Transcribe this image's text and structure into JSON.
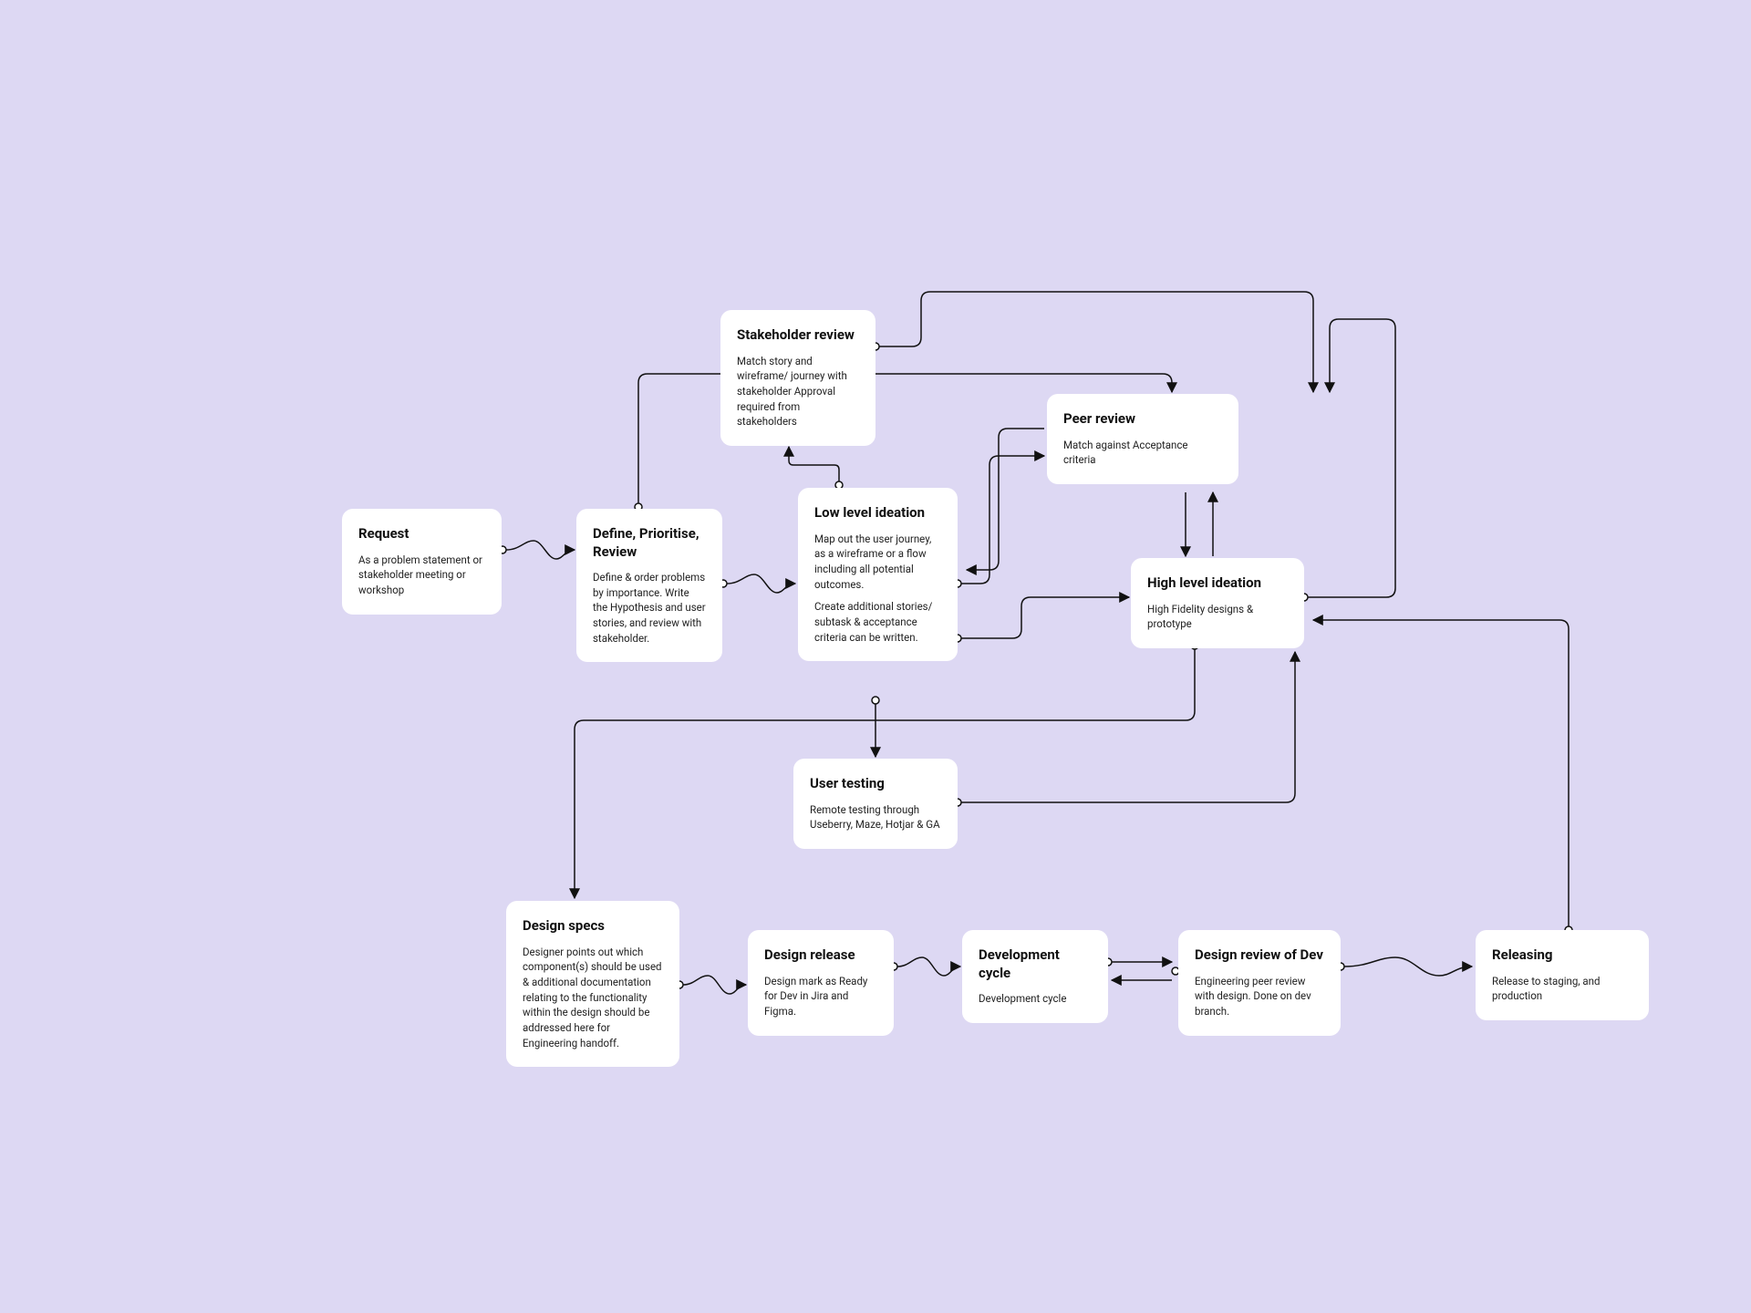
{
  "nodes": {
    "request": {
      "title": "Request",
      "body1": "As a problem statement or stakeholder meeting or workshop"
    },
    "define": {
      "title": "Define, Prioritise, Review",
      "body1": "Define & order problems by importance. Write the Hypothesis and user stories, and review with stakeholder."
    },
    "stakeholder": {
      "title": "Stakeholder review",
      "body1": "Match story and wireframe/ journey with stakeholder Approval required from stakeholders"
    },
    "lowlevel": {
      "title": "Low level ideation",
      "body1": "Map out the user journey, as a wireframe or a flow including all potential outcomes.",
      "body2": "Create additional stories/ subtask & acceptance criteria can be written."
    },
    "peer": {
      "title": "Peer review",
      "body1": "Match against Acceptance criteria"
    },
    "highlevel": {
      "title": "High level ideation",
      "body1": "High Fidelity designs & prototype"
    },
    "usertest": {
      "title": "User testing",
      "body1": "Remote testing through Useberry, Maze, Hotjar & GA"
    },
    "specs": {
      "title": "Design specs",
      "body1": "Designer points out which component(s) should be used & additional documentation relating to the functionality within the design should be addressed here for Engineering handoff."
    },
    "release": {
      "title": "Design release",
      "body1": "Design mark as  Ready for Dev in Jira and Figma."
    },
    "devcycle": {
      "title": "Development cycle",
      "body1": "Development cycle"
    },
    "devreview": {
      "title": "Design review of Dev",
      "body1": "Engineering peer review with design. Done on dev branch."
    },
    "releasing": {
      "title": "Releasing",
      "body1": "Release to staging, and production"
    }
  }
}
